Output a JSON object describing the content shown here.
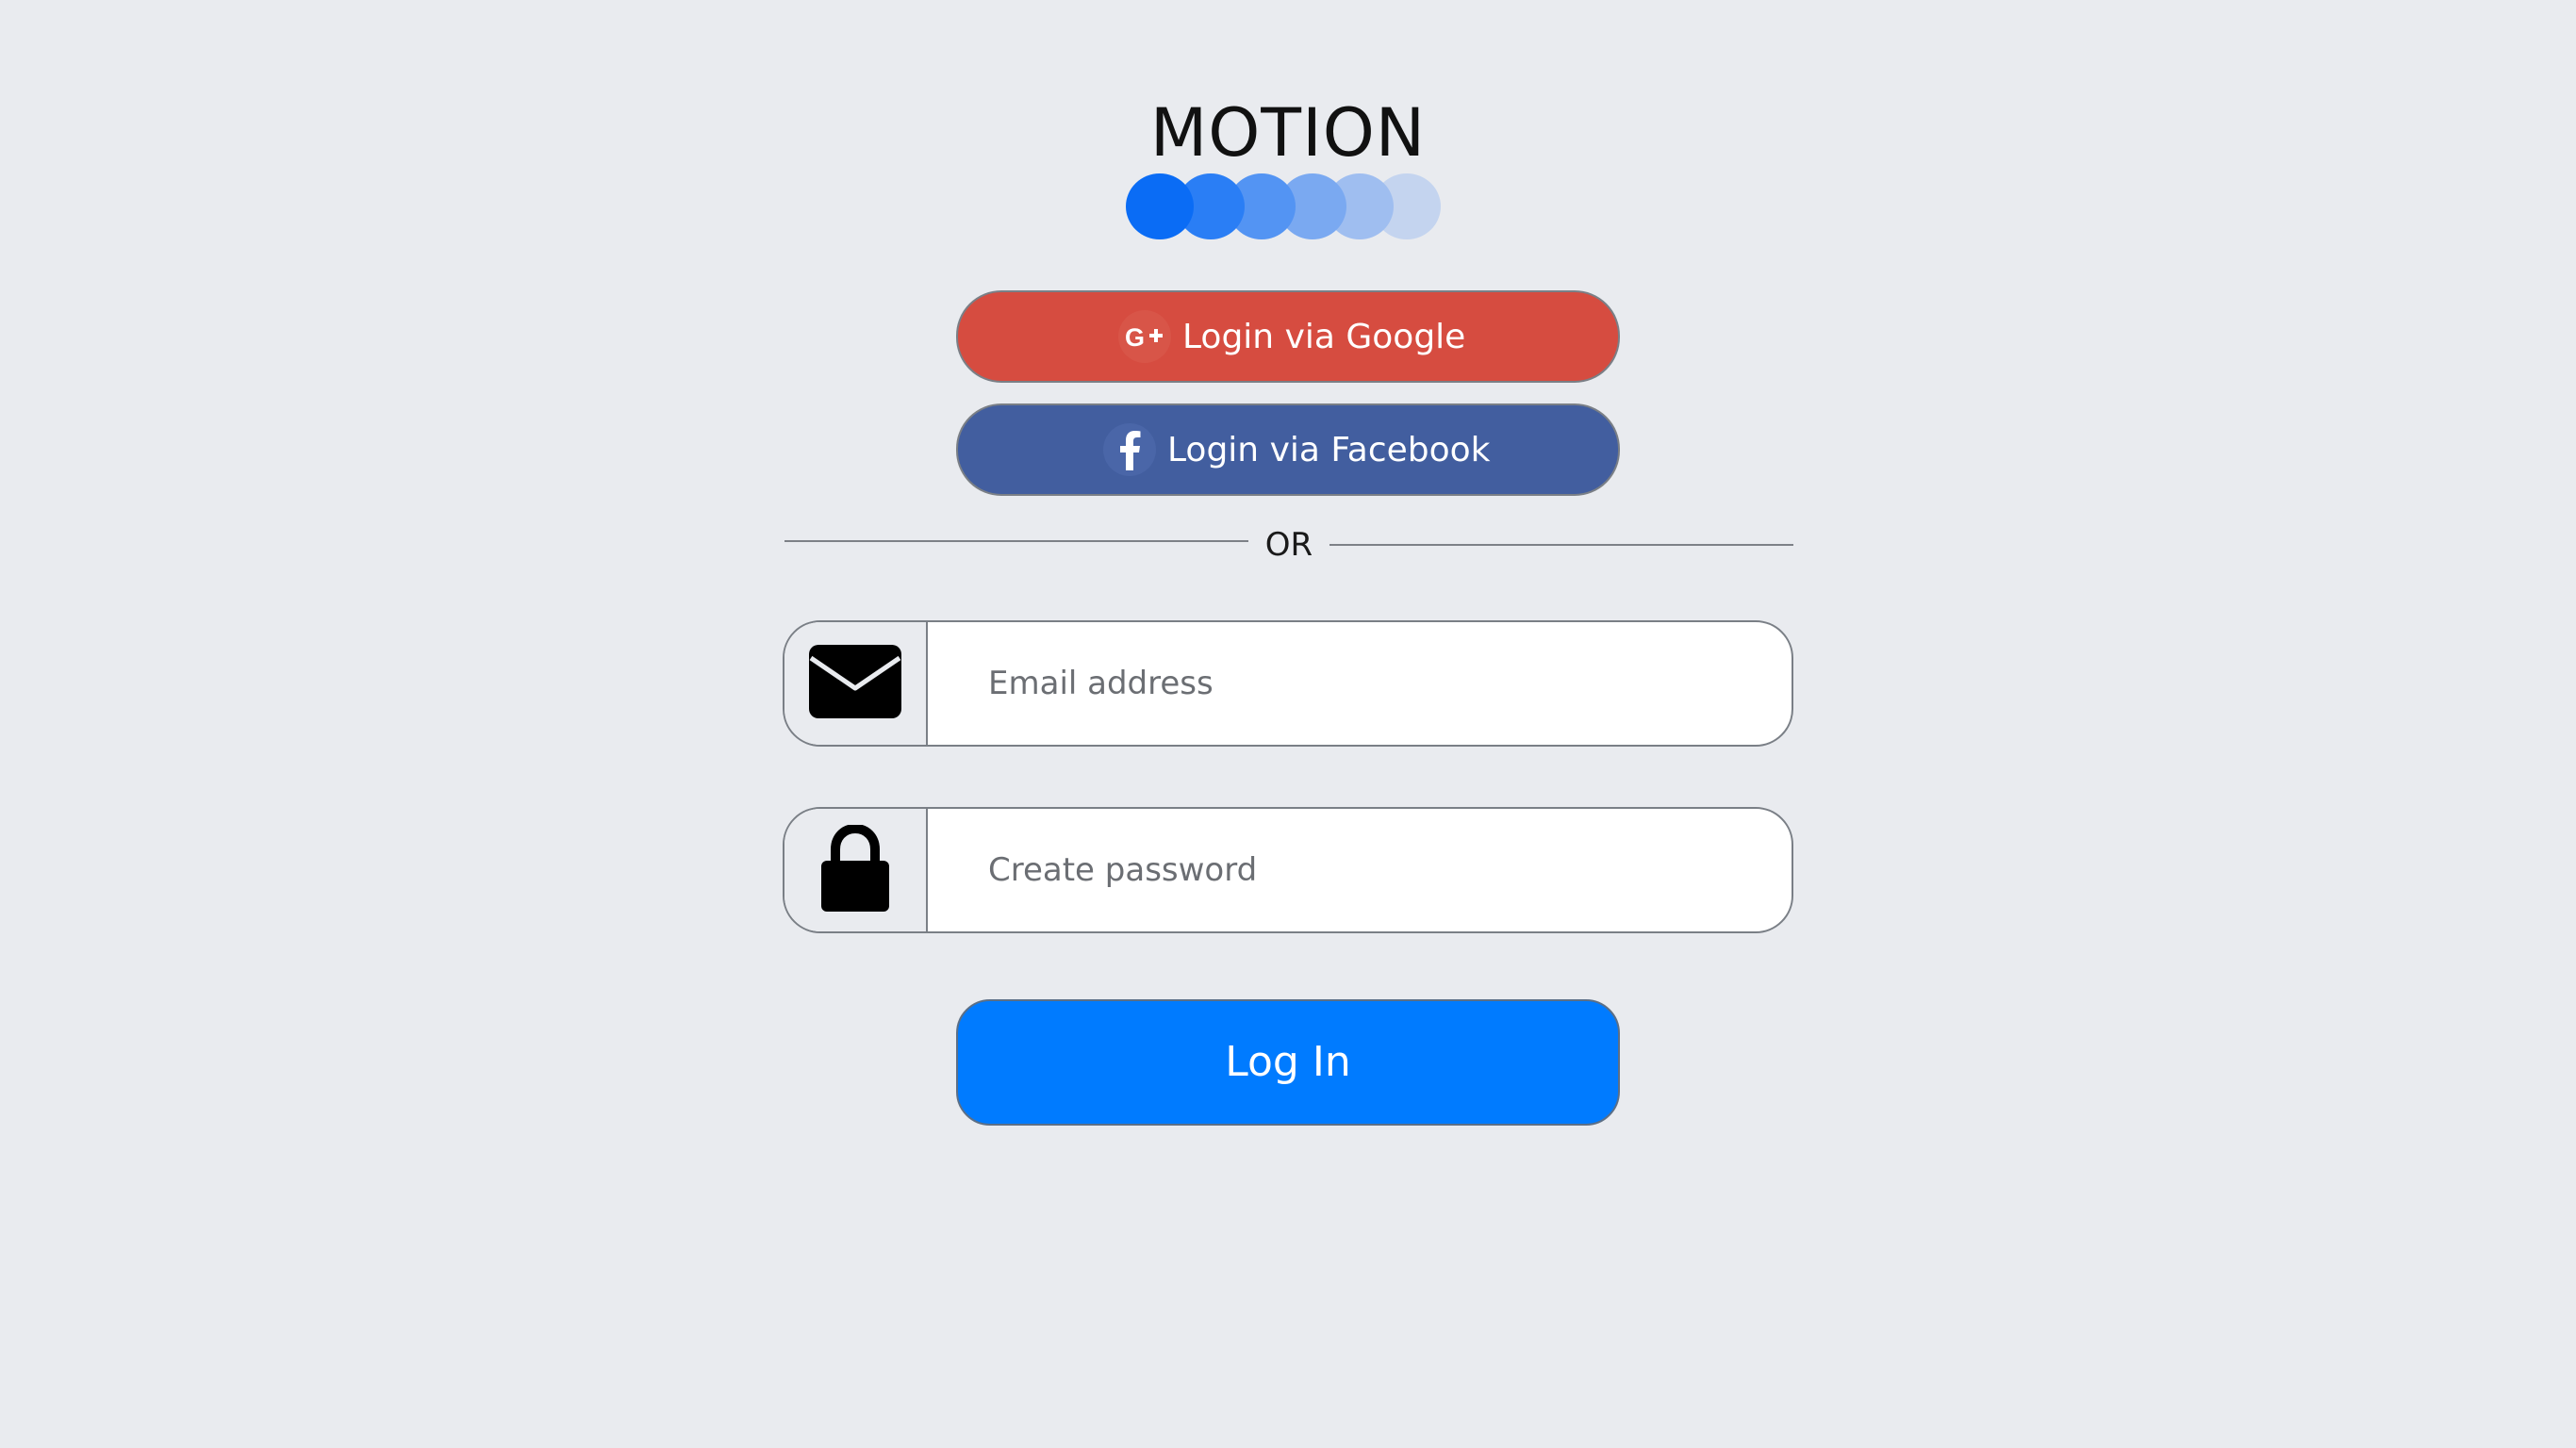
{
  "brand": {
    "title": "MOTION",
    "dot_colors": [
      "#0a6cf5",
      "#2a7ef5",
      "#5394f3",
      "#7aa9f1",
      "#9fbef0",
      "#c4d4ef"
    ]
  },
  "social": {
    "google_label": "Login via Google",
    "google_icon": "google-plus-icon",
    "google_color": "#d64c40",
    "facebook_label": "Login via Facebook",
    "facebook_icon": "facebook-icon",
    "facebook_color": "#425e9f"
  },
  "divider": {
    "text": "OR"
  },
  "form": {
    "email_placeholder": "Email address",
    "email_value": "",
    "email_icon": "envelope-icon",
    "password_placeholder": "Create password",
    "password_value": "",
    "password_icon": "lock-icon",
    "submit_label": "Log In",
    "submit_color": "#007bff"
  }
}
